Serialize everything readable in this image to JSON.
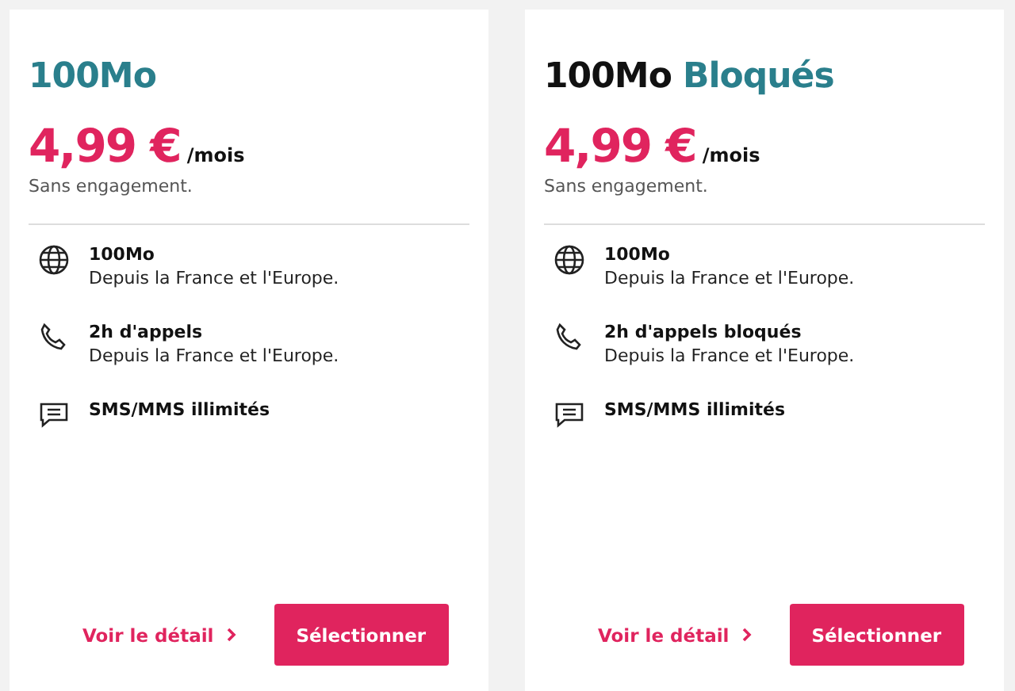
{
  "plans": [
    {
      "title": [
        {
          "text": "100Mo",
          "accent": true
        }
      ],
      "price": "4,99 €",
      "period": "/mois",
      "commitment": "Sans engagement.",
      "features": [
        {
          "kind": "globe",
          "title": "100Mo",
          "detail": "Depuis la France et l'Europe."
        },
        {
          "kind": "phone",
          "title": "2h d'appels",
          "detail": "Depuis la France et l'Europe."
        },
        {
          "kind": "message",
          "title": "SMS/MMS illimités"
        }
      ],
      "link": "Voir le détail",
      "button": "Sélectionner"
    },
    {
      "title": [
        {
          "text": "100Mo",
          "accent": false
        },
        {
          "text": "Bloqués",
          "accent": true
        }
      ],
      "price": "4,99 €",
      "period": "/mois",
      "commitment": "Sans engagement.",
      "features": [
        {
          "kind": "globe",
          "title": "100Mo",
          "detail": "Depuis la France et l'Europe."
        },
        {
          "kind": "phone",
          "title": "2h d'appels bloqués",
          "detail": "Depuis la France et l'Europe."
        },
        {
          "kind": "message",
          "title": "SMS/MMS illimités"
        }
      ],
      "link": "Voir le détail",
      "button": "Sélectionner"
    }
  ]
}
